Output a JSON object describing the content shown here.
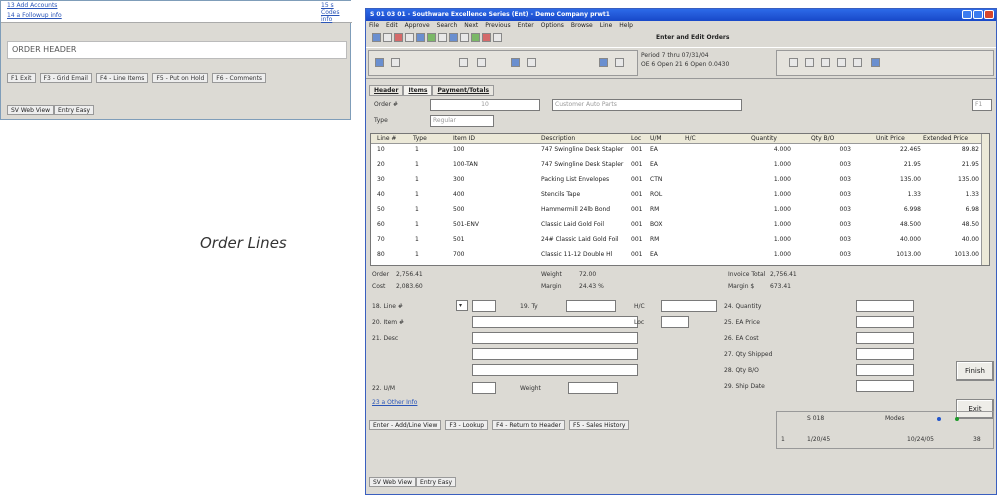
{
  "bg_window": {
    "links": [
      "13 Add Accounts",
      "14 a Followup info",
      "15 s Codes info"
    ],
    "order_header": "ORDER HEADER",
    "fkeys": [
      "F1 Exit",
      "F3 - Grid Email",
      "F4 - Line Items",
      "F5 - Put on Hold",
      "F6 - Comments"
    ],
    "tabs": [
      "SV Web View",
      "Entry Easy"
    ]
  },
  "caption": "Order Lines",
  "main": {
    "title": "S 01 03 01 - Southware Excellence Series (Ent) - Demo Company prwt1",
    "menu": [
      "File",
      "Edit",
      "Approve",
      "Search",
      "Next",
      "Previous",
      "Enter",
      "Options",
      "Browse",
      "Line",
      "Help"
    ],
    "toolbar_title": "Enter and Edit Orders",
    "period_line1": "Period 7 thru 07/31/04",
    "period_line2": "OE 6 Open 21 6 Open 0.0430",
    "tabs": [
      "Header",
      "Items",
      "Payment/Totals"
    ],
    "order_label": "Order #",
    "order_value": "10",
    "order_customer": "Customer Auto Parts",
    "type_label": "Type",
    "type_value": "Regular",
    "aside": "F1",
    "columns": [
      "Line #",
      "Type",
      "Item ID",
      "Description",
      "Loc",
      "U/M",
      "H/C",
      "Quantity",
      "Qty B/O",
      "Unit Price",
      "Extended Price"
    ],
    "rows": [
      [
        "10",
        "1",
        "100",
        "747 Swingline Desk Stapler",
        "001",
        "EA",
        "",
        "4.000",
        "003",
        "22.465",
        "89.82"
      ],
      [
        "20",
        "1",
        "100-TAN",
        "747 Swingline Desk Stapler",
        "001",
        "EA",
        "",
        "1.000",
        "003",
        "21.95",
        "21.95"
      ],
      [
        "30",
        "1",
        "300",
        "Packing List Envelopes",
        "001",
        "CTN",
        "",
        "1.000",
        "003",
        "135.00",
        "135.00"
      ],
      [
        "40",
        "1",
        "400",
        "Stencils Tape",
        "001",
        "ROL",
        "",
        "1.000",
        "003",
        "1.33",
        "1.33"
      ],
      [
        "50",
        "1",
        "500",
        "Hammermill 24lb Bond",
        "001",
        "RM",
        "",
        "1.000",
        "003",
        "6.998",
        "6.98"
      ],
      [
        "60",
        "1",
        "501-ENV",
        "Classic Laid Gold Foil",
        "001",
        "BOX",
        "",
        "1.000",
        "003",
        "48.500",
        "48.50"
      ],
      [
        "70",
        "1",
        "501",
        "24# Classic Laid Gold Foil",
        "001",
        "RM",
        "",
        "1.000",
        "003",
        "40.000",
        "40.00"
      ],
      [
        "80",
        "1",
        "700",
        "Classic 11-12 Double Hl",
        "001",
        "EA",
        "",
        "1.000",
        "003",
        "1013.00",
        "1013.00"
      ]
    ],
    "totals": {
      "order_label": "Order",
      "order_val": "2,756.41",
      "cost_label": "Cost",
      "cost_val": "2,083.60",
      "weight_label": "Weight",
      "weight_val": "72.00",
      "margin_label": "Margin",
      "margin_val": "24.43 %",
      "invoice_label": "Invoice Total",
      "invoice_val": "2,756.41",
      "marginamt_label": "Margin $",
      "marginamt_val": "673.41"
    },
    "form": {
      "line_label": "18. Line #",
      "ty_label": "19. Ty",
      "hc_label": "H/C",
      "item_label": "20. Item #",
      "loc_label": "Loc",
      "desc_label": "21. Desc",
      "um_label": "22. U/M",
      "weight_label": "Weight",
      "link": "23 a Other Info",
      "qty_label": "24. Quantity",
      "price_label": "25. EA Price",
      "cost_label": "26. EA Cost",
      "shipped_label": "27. Qty Shipped",
      "bo_label": "28. Qty B/O",
      "shipdate_label": "29. Ship Date"
    },
    "buttons": {
      "finish": "Finish",
      "exit": "Exit"
    },
    "fkeys": [
      "Enter - Add/Line View",
      "F3 - Lookup",
      "F4 - Return to Header",
      "F5 - Sales History"
    ],
    "status": {
      "left": "S 018",
      "mode": "Modes",
      "date_left": "1/20/45",
      "date": "10/24/05",
      "num": "38",
      "cell1": "1"
    },
    "wtabs": [
      "SV Web View",
      "Entry Easy"
    ]
  }
}
